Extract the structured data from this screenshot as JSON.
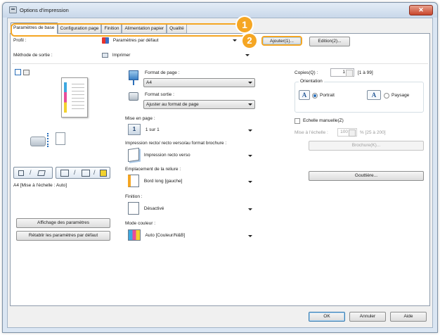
{
  "window": {
    "title": "Options d'impression",
    "close_glyph": "✕"
  },
  "tabs": [
    {
      "label": "Paramètres de base",
      "active": true
    },
    {
      "label": "Configuration page",
      "active": false
    },
    {
      "label": "Finition",
      "active": false
    },
    {
      "label": "Alimentation papier",
      "active": false
    },
    {
      "label": "Qualité",
      "active": false
    }
  ],
  "callouts": {
    "one": "1",
    "two": "2"
  },
  "profile": {
    "label": "Profil :",
    "value": "Paramètres par défaut",
    "add_button": "Ajouter(1)...",
    "edit_button": "Edition(2)..."
  },
  "output_method": {
    "label": "Méthode de sortie :",
    "value": "Imprimer"
  },
  "preview": {
    "caption": "A4 [Mise à l'échelle : Auto]",
    "view_settings_button": "Affichage des paramètres",
    "restore_defaults_button": "Rétablir les paramètres par défaut"
  },
  "page_size": {
    "label": "Format de page :",
    "value": "A4"
  },
  "output_size": {
    "label": "Format sortie :",
    "value": "Ajuster au format de page"
  },
  "layout": {
    "label": "Mise en page :",
    "value": "1 sur 1",
    "icon_text": "1"
  },
  "duplex": {
    "label": "Impression recto/ recto verso/au format brochure :",
    "value": "Impression recto verso"
  },
  "binding": {
    "label": "Emplacement de la reliure :",
    "value": "Bord long [gauche]"
  },
  "finishing": {
    "label": "Finition :",
    "value": "Désactivé"
  },
  "color_mode": {
    "label": "Mode couleur :",
    "value": "Auto [Couleur/N&B]"
  },
  "copies": {
    "label": "Copies(Q) :",
    "value": "1",
    "range": "[1 à 99]"
  },
  "orientation": {
    "label": "Orientation",
    "portrait": "Portrait",
    "landscape": "Paysage",
    "selected": "Portrait",
    "icon_letter": "A"
  },
  "manual_scaling": {
    "label": "Echelle manuelle(Z)",
    "scale_label": "Mise à l'échelle :",
    "scale_value": "100",
    "scale_range": "% [25 à 200]"
  },
  "booklet_button": "Brochure(K)...",
  "gutter_button": "Gouttière...",
  "footer": {
    "ok": "OK",
    "cancel": "Annuler",
    "help": "Aide"
  },
  "colors": {
    "accent": "#f5a623",
    "selection": "#2a6fba",
    "close": "#c8452c"
  }
}
